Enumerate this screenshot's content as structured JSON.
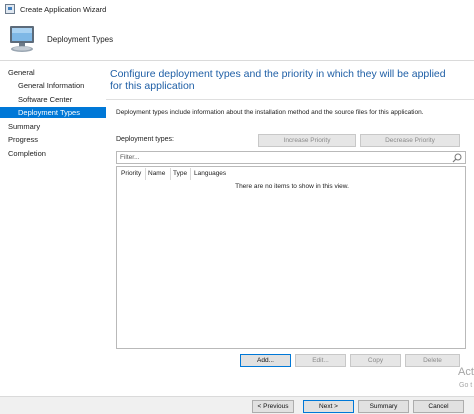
{
  "window": {
    "title": "Create Application Wizard",
    "icon": "wizard-app-icon"
  },
  "header": {
    "icon": "computer-icon",
    "heading": "Deployment Types"
  },
  "sidebar": {
    "items": [
      {
        "label": "General",
        "indent": 0
      },
      {
        "label": "General Information",
        "indent": 1
      },
      {
        "label": "Software Center",
        "indent": 1
      },
      {
        "label": "Deployment Types",
        "indent": 1,
        "active": true
      },
      {
        "label": "Summary",
        "indent": 0
      },
      {
        "label": "Progress",
        "indent": 0
      },
      {
        "label": "Completion",
        "indent": 0
      }
    ]
  },
  "main": {
    "heading": "Configure deployment types and the priority in which they will be applied for this application",
    "description": "Deployment types include information about the installation method and the source files for this application.",
    "deployment_types_label": "Deployment types:",
    "increase_priority": "Increase Priority",
    "decrease_priority": "Decrease Priority",
    "filter_placeholder": "Filter...",
    "columns": [
      "Priority",
      "Name",
      "Type",
      "Languages"
    ],
    "empty_message": "There are no items to show in this view.",
    "add": "Add...",
    "edit": "Edit...",
    "copy": "Copy",
    "delete": "Delete"
  },
  "footer": {
    "previous": "< Previous",
    "next": "Next >",
    "summary": "Summary",
    "cancel": "Cancel"
  },
  "watermark": {
    "line1": "Act",
    "line2": "Go t"
  },
  "colors": {
    "accent": "#0078d7",
    "heading": "#1f5fa6"
  }
}
